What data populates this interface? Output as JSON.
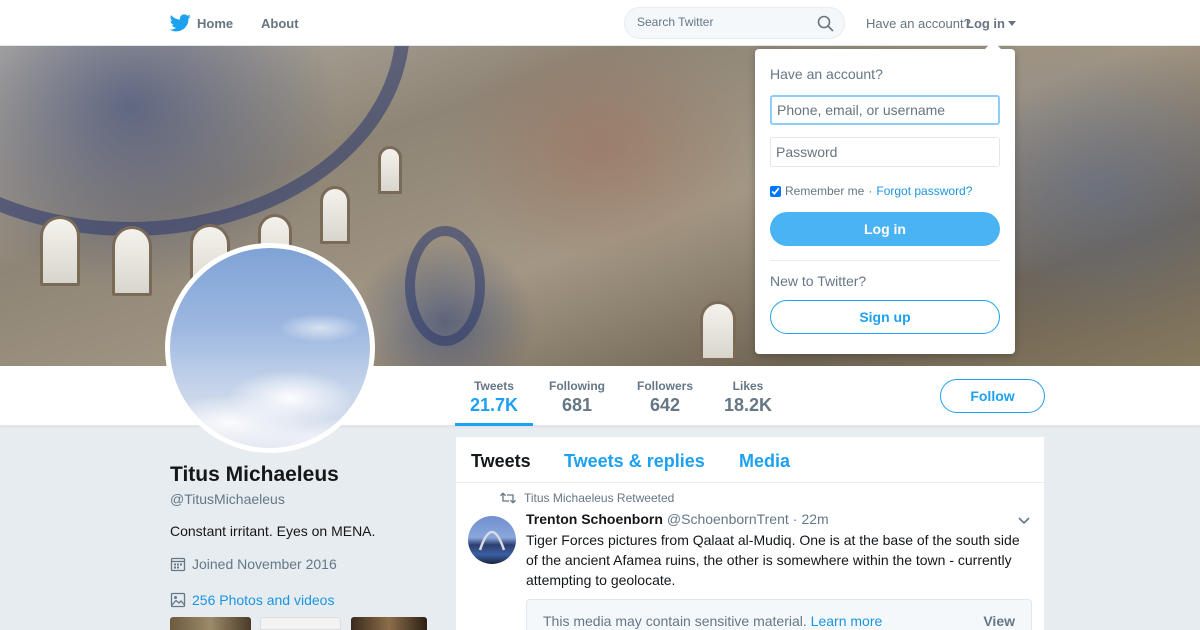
{
  "nav": {
    "home_label": "Home",
    "about_label": "About",
    "search_placeholder": "Search Twitter",
    "have_account": "Have an account?",
    "login_label": "Log in"
  },
  "profile": {
    "name": "Titus Michaeleus",
    "handle": "@TitusMichaeleus",
    "bio": "Constant irritant. Eyes on MENA.",
    "joined": "Joined November 2016",
    "photos_label": "256 Photos and videos",
    "stats": [
      {
        "label": "Tweets",
        "value": "21.7K"
      },
      {
        "label": "Following",
        "value": "681"
      },
      {
        "label": "Followers",
        "value": "642"
      },
      {
        "label": "Likes",
        "value": "18.2K"
      }
    ],
    "follow_label": "Follow"
  },
  "timeline": {
    "tabs": [
      "Tweets",
      "Tweets & replies",
      "Media"
    ],
    "tweet": {
      "retweeted_by": "Titus Michaeleus Retweeted",
      "author_name": "Trenton Schoenborn",
      "author_handle": "@SchoenbornTrent",
      "separator": "·",
      "time": "22m",
      "text": "Tiger Forces pictures from Qalaat al-Mudiq. One is at the base of the south side of the ancient Afamea ruins, the other is somewhere within the town - currently attempting to geolocate.",
      "sensitive_text": "This media may contain sensitive material.",
      "learn_more": "Learn more",
      "view_label": "View"
    }
  },
  "login_dropdown": {
    "title": "Have an account?",
    "username_placeholder": "Phone, email, or username",
    "password_placeholder": "Password",
    "remember_label": "Remember me",
    "separator": "·",
    "forgot_label": "Forgot password?",
    "login_button": "Log in",
    "new_to_twitter": "New to Twitter?",
    "signup_button": "Sign up"
  },
  "colors": {
    "accent": "#1da1f2",
    "link": "#1b95e0",
    "login_button": "#4ab3f4",
    "page_background": "#e6ecf0"
  },
  "icons": [
    "twitter-bird-icon",
    "search-icon",
    "caret-down-icon",
    "calendar-icon",
    "photo-icon",
    "retweet-icon",
    "chevron-down-icon"
  ]
}
